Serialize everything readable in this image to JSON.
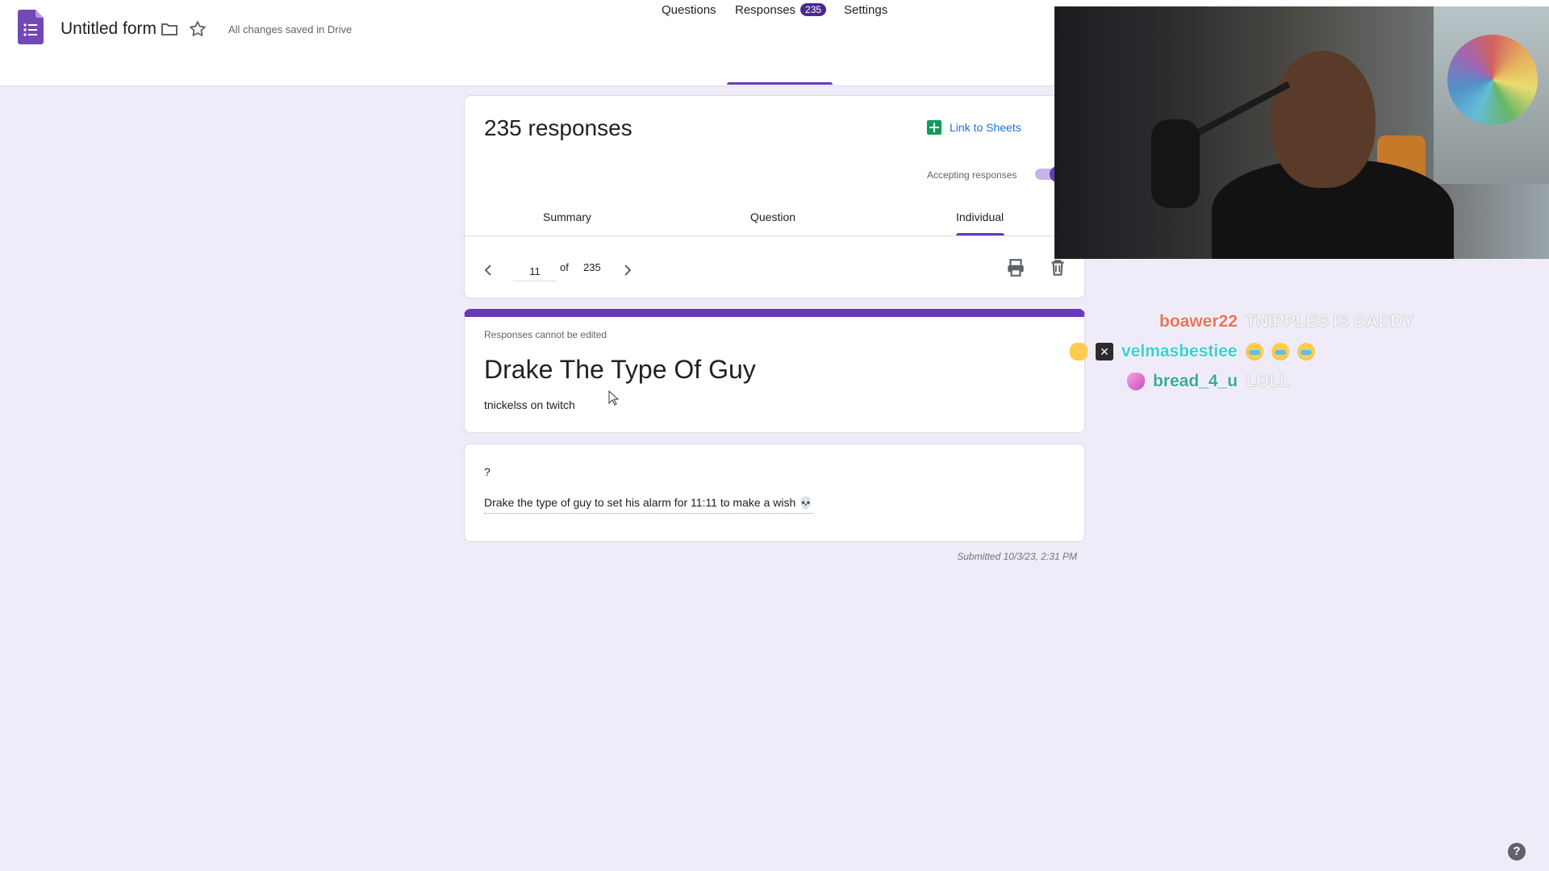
{
  "app": {
    "form_title": "Untitled form",
    "saved_status": "All changes saved in Drive"
  },
  "main_tabs": [
    {
      "label": "Questions"
    },
    {
      "label": "Responses",
      "badge": "235",
      "active": true
    },
    {
      "label": "Settings"
    }
  ],
  "responses_header": {
    "count_title": "235 responses",
    "link_to_sheets": "Link to Sheets",
    "accepting_label": "Accepting responses",
    "accepting_on": true
  },
  "sub_tabs": [
    {
      "label": "Summary"
    },
    {
      "label": "Question"
    },
    {
      "label": "Individual",
      "active": true
    }
  ],
  "pager": {
    "current": "11",
    "of_label": "of",
    "total": "235"
  },
  "response": {
    "cannot_edit_notice": "Responses cannot be edited",
    "title": "Drake The Type Of Guy",
    "description": "tnickelss on twitch",
    "question": "?",
    "answer": "Drake the type of guy to set his alarm for 11:11 to make a wish 💀",
    "submitted": "Submitted 10/3/23, 2:31 PM"
  },
  "chat": [
    {
      "user": "boawer22",
      "user_color": "#e8735a",
      "message": "TNIPPLES IS DADDY",
      "emotes": []
    },
    {
      "user": "velmasbestiee",
      "user_color": "#3ad1d6",
      "message": "",
      "emotes": [
        "sob-emote",
        "sob-emote",
        "sob-emote"
      ]
    },
    {
      "user": "bread_4_u",
      "user_color": "#3aa8a0",
      "message": "LOLL",
      "emotes": []
    }
  ],
  "colors": {
    "accent": "#673ab7",
    "background": "#f0ebf8",
    "link": "#1a73e8",
    "sheets_green": "#0f9d58"
  }
}
